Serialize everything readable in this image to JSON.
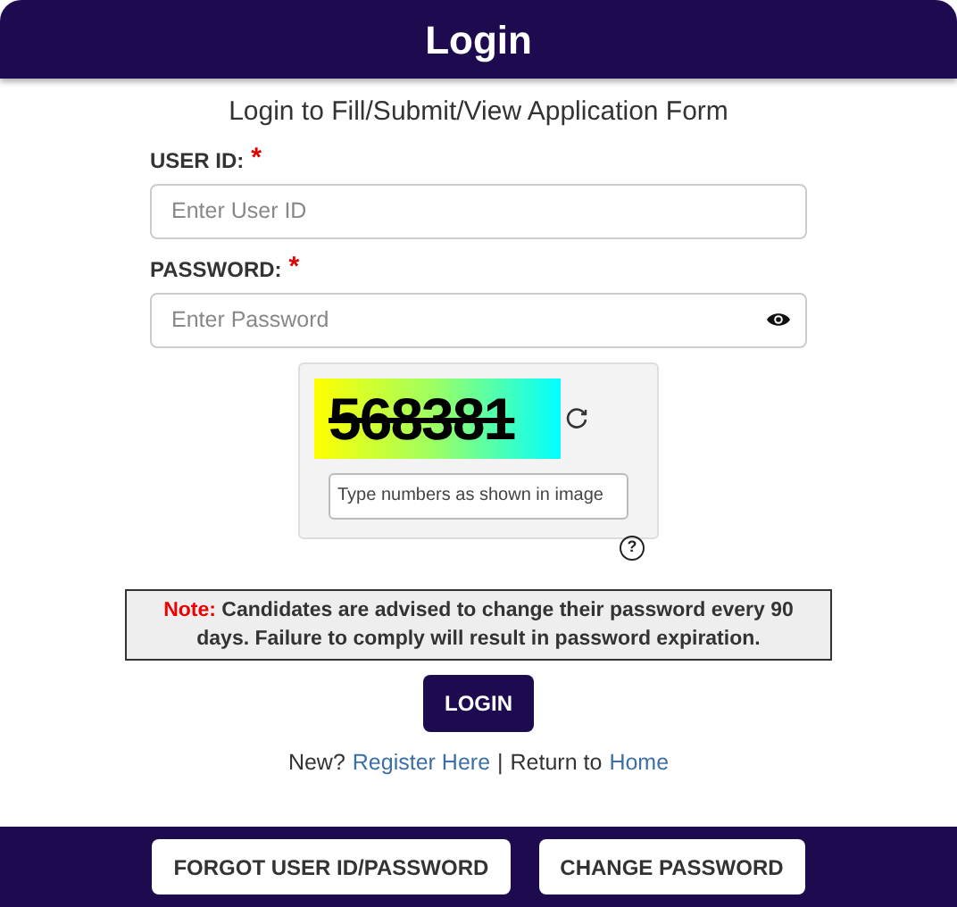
{
  "header": {
    "title": "Login"
  },
  "subtitle": "Login to Fill/Submit/View Application Form",
  "fields": [
    {
      "label": "USER ID:",
      "required_mark": "*",
      "placeholder": "Enter User ID",
      "kind": "text"
    },
    {
      "label": "PASSWORD:",
      "required_mark": "*",
      "placeholder": "Enter Password",
      "kind": "password"
    }
  ],
  "captcha": {
    "code": "568381",
    "placeholder": "Type numbers as shown in image",
    "help": "?"
  },
  "note": {
    "label": "Note:",
    "text": "Candidates are advised to change their password every 90 days. Failure to comply will result in password expiration."
  },
  "login_button": "LOGIN",
  "links": [
    {
      "kind": "text",
      "text": "New?"
    },
    {
      "kind": "link",
      "text": "Register Here"
    },
    {
      "kind": "text",
      "text": "|"
    },
    {
      "kind": "text",
      "text": "Return to"
    },
    {
      "kind": "link",
      "text": "Home"
    }
  ],
  "footer_buttons": [
    "FORGOT USER ID/PASSWORD",
    "CHANGE PASSWORD"
  ]
}
